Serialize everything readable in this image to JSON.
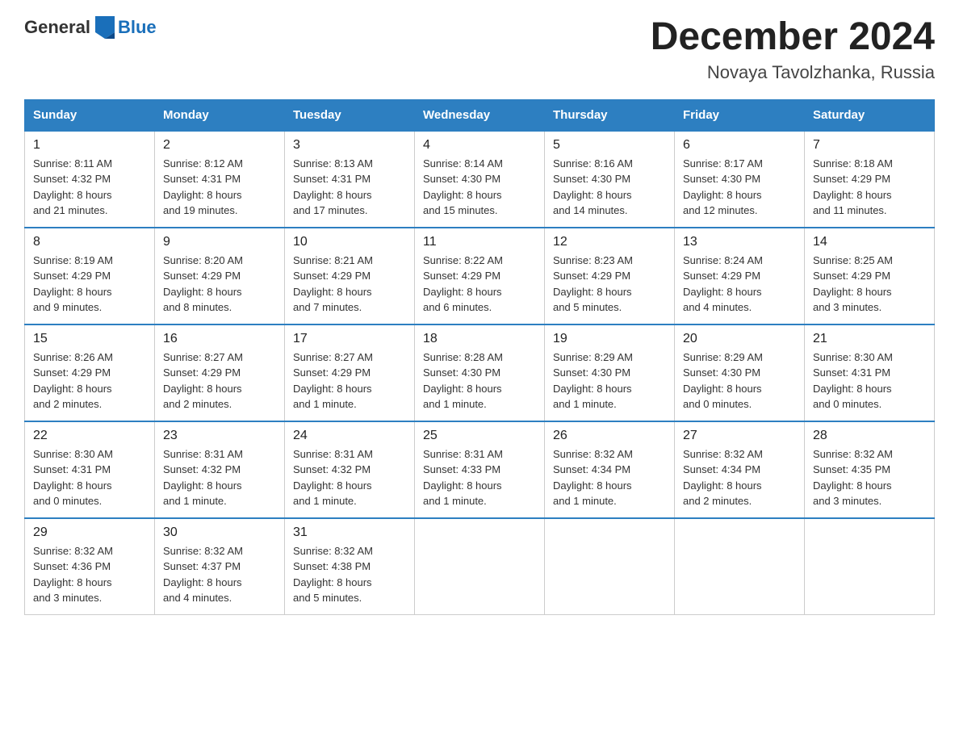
{
  "header": {
    "logo_general": "General",
    "logo_blue": "Blue",
    "month_title": "December 2024",
    "subtitle": "Novaya Tavolzhanka, Russia"
  },
  "days_of_week": [
    "Sunday",
    "Monday",
    "Tuesday",
    "Wednesday",
    "Thursday",
    "Friday",
    "Saturday"
  ],
  "weeks": [
    [
      {
        "day": "1",
        "sunrise": "8:11 AM",
        "sunset": "4:32 PM",
        "daylight": "8 hours and 21 minutes."
      },
      {
        "day": "2",
        "sunrise": "8:12 AM",
        "sunset": "4:31 PM",
        "daylight": "8 hours and 19 minutes."
      },
      {
        "day": "3",
        "sunrise": "8:13 AM",
        "sunset": "4:31 PM",
        "daylight": "8 hours and 17 minutes."
      },
      {
        "day": "4",
        "sunrise": "8:14 AM",
        "sunset": "4:30 PM",
        "daylight": "8 hours and 15 minutes."
      },
      {
        "day": "5",
        "sunrise": "8:16 AM",
        "sunset": "4:30 PM",
        "daylight": "8 hours and 14 minutes."
      },
      {
        "day": "6",
        "sunrise": "8:17 AM",
        "sunset": "4:30 PM",
        "daylight": "8 hours and 12 minutes."
      },
      {
        "day": "7",
        "sunrise": "8:18 AM",
        "sunset": "4:29 PM",
        "daylight": "8 hours and 11 minutes."
      }
    ],
    [
      {
        "day": "8",
        "sunrise": "8:19 AM",
        "sunset": "4:29 PM",
        "daylight": "8 hours and 9 minutes."
      },
      {
        "day": "9",
        "sunrise": "8:20 AM",
        "sunset": "4:29 PM",
        "daylight": "8 hours and 8 minutes."
      },
      {
        "day": "10",
        "sunrise": "8:21 AM",
        "sunset": "4:29 PM",
        "daylight": "8 hours and 7 minutes."
      },
      {
        "day": "11",
        "sunrise": "8:22 AM",
        "sunset": "4:29 PM",
        "daylight": "8 hours and 6 minutes."
      },
      {
        "day": "12",
        "sunrise": "8:23 AM",
        "sunset": "4:29 PM",
        "daylight": "8 hours and 5 minutes."
      },
      {
        "day": "13",
        "sunrise": "8:24 AM",
        "sunset": "4:29 PM",
        "daylight": "8 hours and 4 minutes."
      },
      {
        "day": "14",
        "sunrise": "8:25 AM",
        "sunset": "4:29 PM",
        "daylight": "8 hours and 3 minutes."
      }
    ],
    [
      {
        "day": "15",
        "sunrise": "8:26 AM",
        "sunset": "4:29 PM",
        "daylight": "8 hours and 2 minutes."
      },
      {
        "day": "16",
        "sunrise": "8:27 AM",
        "sunset": "4:29 PM",
        "daylight": "8 hours and 2 minutes."
      },
      {
        "day": "17",
        "sunrise": "8:27 AM",
        "sunset": "4:29 PM",
        "daylight": "8 hours and 1 minute."
      },
      {
        "day": "18",
        "sunrise": "8:28 AM",
        "sunset": "4:30 PM",
        "daylight": "8 hours and 1 minute."
      },
      {
        "day": "19",
        "sunrise": "8:29 AM",
        "sunset": "4:30 PM",
        "daylight": "8 hours and 1 minute."
      },
      {
        "day": "20",
        "sunrise": "8:29 AM",
        "sunset": "4:30 PM",
        "daylight": "8 hours and 0 minutes."
      },
      {
        "day": "21",
        "sunrise": "8:30 AM",
        "sunset": "4:31 PM",
        "daylight": "8 hours and 0 minutes."
      }
    ],
    [
      {
        "day": "22",
        "sunrise": "8:30 AM",
        "sunset": "4:31 PM",
        "daylight": "8 hours and 0 minutes."
      },
      {
        "day": "23",
        "sunrise": "8:31 AM",
        "sunset": "4:32 PM",
        "daylight": "8 hours and 1 minute."
      },
      {
        "day": "24",
        "sunrise": "8:31 AM",
        "sunset": "4:32 PM",
        "daylight": "8 hours and 1 minute."
      },
      {
        "day": "25",
        "sunrise": "8:31 AM",
        "sunset": "4:33 PM",
        "daylight": "8 hours and 1 minute."
      },
      {
        "day": "26",
        "sunrise": "8:32 AM",
        "sunset": "4:34 PM",
        "daylight": "8 hours and 1 minute."
      },
      {
        "day": "27",
        "sunrise": "8:32 AM",
        "sunset": "4:34 PM",
        "daylight": "8 hours and 2 minutes."
      },
      {
        "day": "28",
        "sunrise": "8:32 AM",
        "sunset": "4:35 PM",
        "daylight": "8 hours and 3 minutes."
      }
    ],
    [
      {
        "day": "29",
        "sunrise": "8:32 AM",
        "sunset": "4:36 PM",
        "daylight": "8 hours and 3 minutes."
      },
      {
        "day": "30",
        "sunrise": "8:32 AM",
        "sunset": "4:37 PM",
        "daylight": "8 hours and 4 minutes."
      },
      {
        "day": "31",
        "sunrise": "8:32 AM",
        "sunset": "4:38 PM",
        "daylight": "8 hours and 5 minutes."
      },
      null,
      null,
      null,
      null
    ]
  ],
  "labels": {
    "sunrise": "Sunrise:",
    "sunset": "Sunset:",
    "daylight": "Daylight:"
  }
}
